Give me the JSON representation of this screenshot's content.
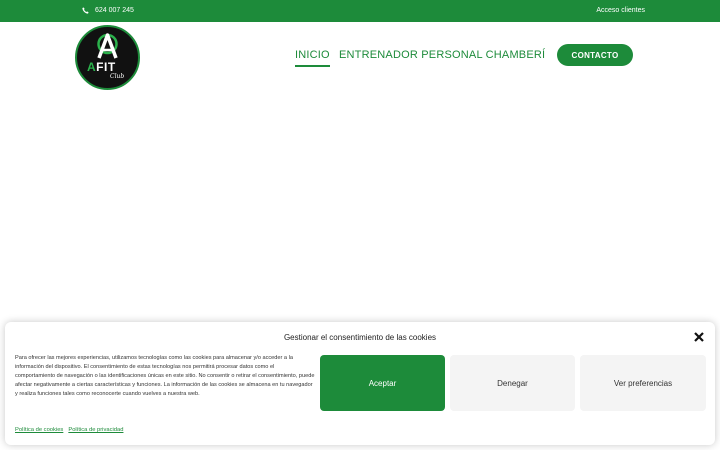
{
  "topbar": {
    "phone": "624 007 245",
    "access": "Acceso clientes"
  },
  "logo": {
    "brand_a": "A",
    "brand_rest": "FIT",
    "club": "Club"
  },
  "nav": {
    "inicio": "INICIO",
    "entrenador": "ENTRENADOR PERSONAL CHAMBERÍ",
    "contacto": "CONTACTO"
  },
  "cookie": {
    "title": "Gestionar el consentimiento de las cookies",
    "text": "Para ofrecer las mejores experiencias, utilizamos tecnologías como las cookies para almacenar y/o acceder a la información del dispositivo. El consentimiento de estas tecnologías nos permitirá procesar datos como el comportamiento de navegación o las identificaciones únicas en este sitio. No consentir o retirar el consentimiento, puede afectar negativamente a ciertas características y funciones. La información de las cookies se almacena en tu navegador y realiza funciones tales como reconocerte cuando vuelves a nuestra web.",
    "accept": "Aceptar",
    "deny": "Denegar",
    "preferences": "Ver preferencias",
    "link_cookies": "Política de cookies",
    "link_privacy": "Política de privacidad"
  },
  "colors": {
    "brand_green": "#1d8b3a",
    "logo_bg": "#111111"
  },
  "icons": {
    "phone": "phone-icon",
    "close": "close-icon"
  }
}
